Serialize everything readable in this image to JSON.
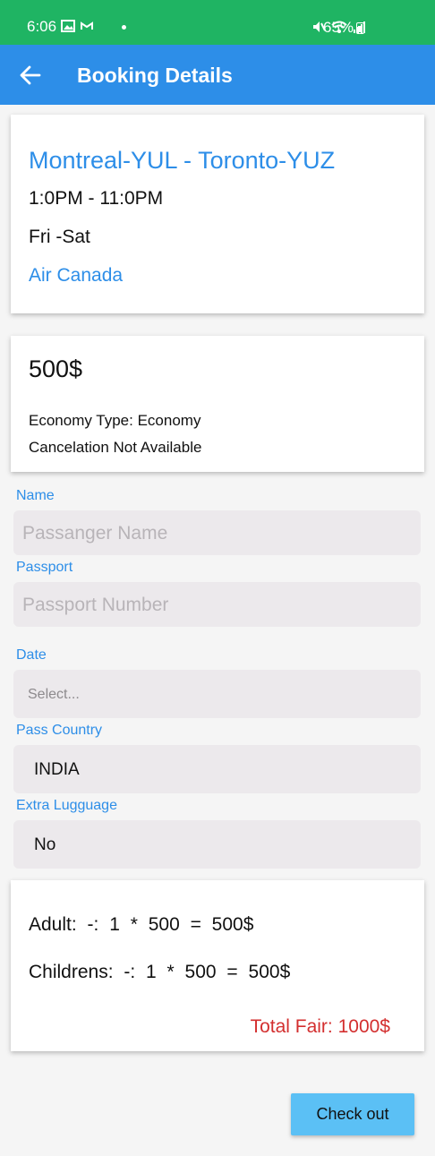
{
  "status": {
    "time": "6:06",
    "battery": "65%"
  },
  "appbar": {
    "title": "Booking Details"
  },
  "flight": {
    "route": "Montreal-YUL - Toronto-YUZ",
    "times": "1:0PM - 11:0PM",
    "days": "Fri -Sat",
    "airline": "Air Canada"
  },
  "fare": {
    "price": "500$",
    "economy": "Economy Type:  Economy",
    "cancellation": "Cancelation Not Available"
  },
  "form": {
    "name_label": "Name",
    "name_placeholder": "Passanger Name",
    "passport_label": "Passport",
    "passport_placeholder": "Passport Number",
    "date_label": "Date",
    "date_placeholder": "Select...",
    "country_label": "Pass Country",
    "country_value": "INDIA",
    "luggage_label": "Extra Lugguage",
    "luggage_value": "No"
  },
  "summary": {
    "adult": "Adult:   -:  1  *  500  =   500$",
    "children": "Childrens:   -:  1  *  500  =  500$",
    "total": "Total Fair:  1000$"
  },
  "actions": {
    "checkout": "Check out"
  },
  "colors": {
    "status_bar": "#1fb463",
    "app_bar": "#2d8ee8",
    "accent": "#2d8ee8",
    "total": "#d32f2f",
    "button": "#5bc0f5"
  }
}
